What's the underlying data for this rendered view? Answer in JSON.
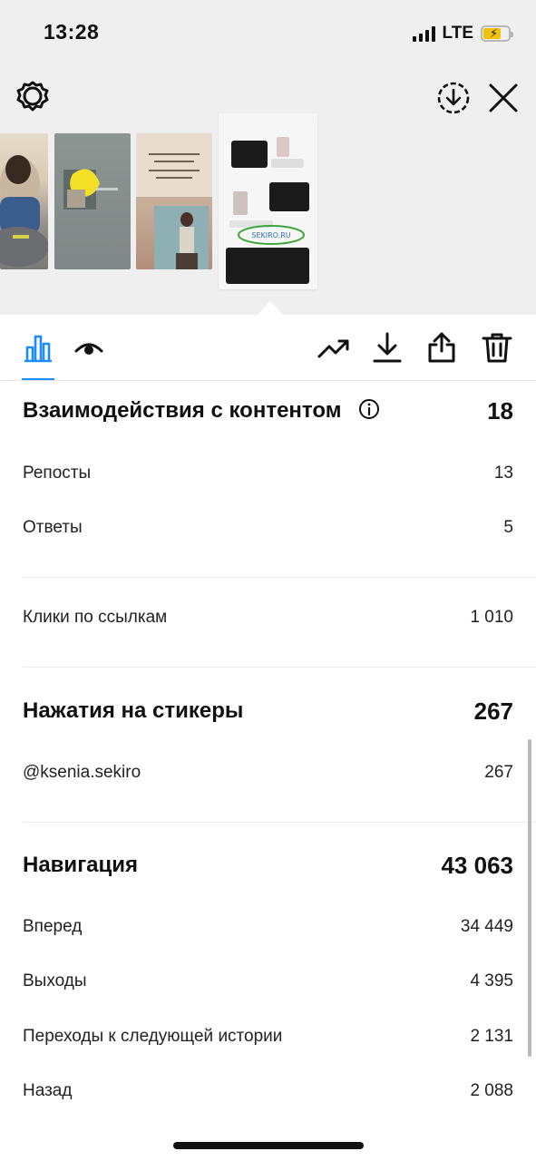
{
  "status_bar": {
    "time": "13:28",
    "network": "LTE"
  },
  "icons": {
    "settings": "gear-icon",
    "download_circle": "download-circle-icon",
    "close": "close-icon",
    "insights_tab": "bar-chart-icon",
    "viewers_tab": "eye-icon",
    "promote": "trending-up-icon",
    "download": "download-icon",
    "share": "share-icon",
    "delete": "trash-icon",
    "info": "info-icon"
  },
  "colors": {
    "accent": "#1a8cff",
    "battery": "#f2c20b"
  },
  "stories": {
    "thumb3_text": "Это я снова слушаю в слушаю как... Захотели попробовать по себя высказаться...",
    "thumb4_link": "SEKIRO.RU"
  },
  "interactions": {
    "title": "Взаимодействия с контентом",
    "total": "18"
  },
  "rows_interactions": [
    {
      "label": "Репосты",
      "value": "13"
    },
    {
      "label": "Ответы",
      "value": "5"
    }
  ],
  "link_clicks": {
    "label": "Клики по ссылкам",
    "value": "1 010"
  },
  "stickers": {
    "title": "Нажатия на стикеры",
    "total": "267"
  },
  "stickers_rows": [
    {
      "label": "@ksenia.sekiro",
      "value": "267"
    }
  ],
  "navigation": {
    "title": "Навигация",
    "total": "43 063"
  },
  "navigation_rows": [
    {
      "label": "Вперед",
      "value": "34 449"
    },
    {
      "label": "Выходы",
      "value": "4 395"
    },
    {
      "label": "Переходы к следующей истории",
      "value": "2 131"
    },
    {
      "label": "Назад",
      "value": "2 088"
    }
  ]
}
